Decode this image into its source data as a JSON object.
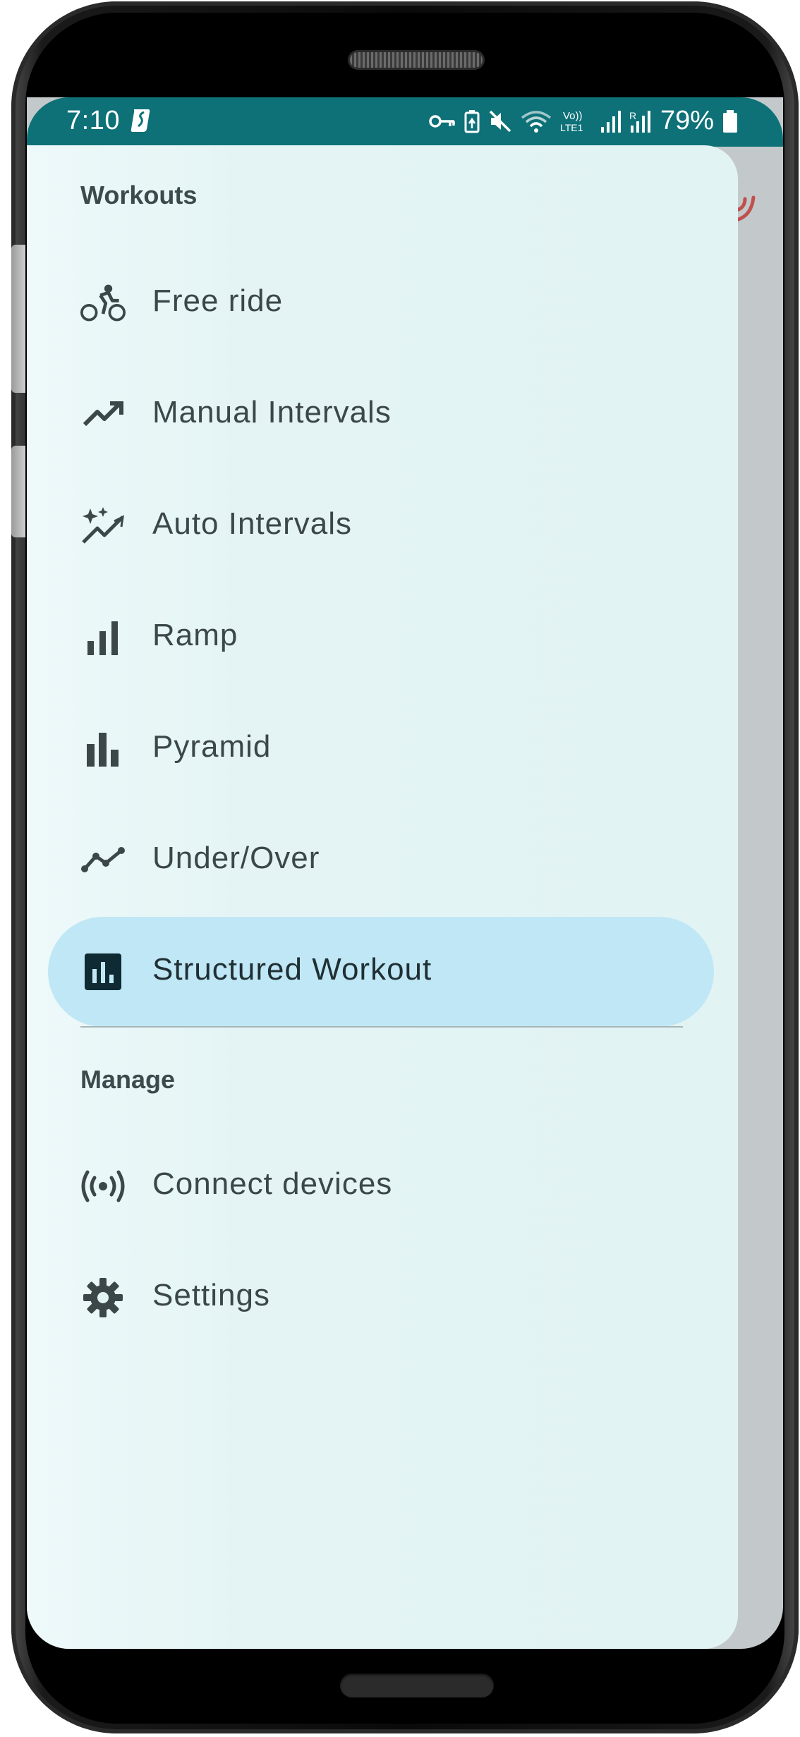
{
  "status_bar": {
    "time": "7:10",
    "battery_percent": "79%",
    "icons": [
      "vpn-key-icon",
      "battery-saver-icon",
      "mute-icon",
      "wifi-icon",
      "volte-icon",
      "signal-icon",
      "signal-r-icon",
      "battery-icon"
    ],
    "volte_top": "Vo))",
    "volte_bottom": "LTE1",
    "background_color": "#0e7178"
  },
  "drawer": {
    "sections": [
      {
        "title": "Workouts",
        "items": [
          {
            "label": "Free ride",
            "icon": "bike-icon"
          },
          {
            "label": "Manual Intervals",
            "icon": "trending-up-icon"
          },
          {
            "label": "Auto Intervals",
            "icon": "auto-graph-icon"
          },
          {
            "label": "Ramp",
            "icon": "signal-bars-icon"
          },
          {
            "label": "Pyramid",
            "icon": "bar-chart-icon"
          },
          {
            "label": "Under/Over",
            "icon": "multiline-chart-icon"
          },
          {
            "label": "Structured Workout",
            "icon": "insert-chart-icon",
            "selected": true
          }
        ]
      },
      {
        "title": "Manage",
        "items": [
          {
            "label": "Connect devices",
            "icon": "broadcast-icon"
          },
          {
            "label": "Settings",
            "icon": "gear-icon"
          }
        ]
      }
    ],
    "active_highlight_color": "#c0e7f6",
    "background_color": "#e2f3f3"
  }
}
